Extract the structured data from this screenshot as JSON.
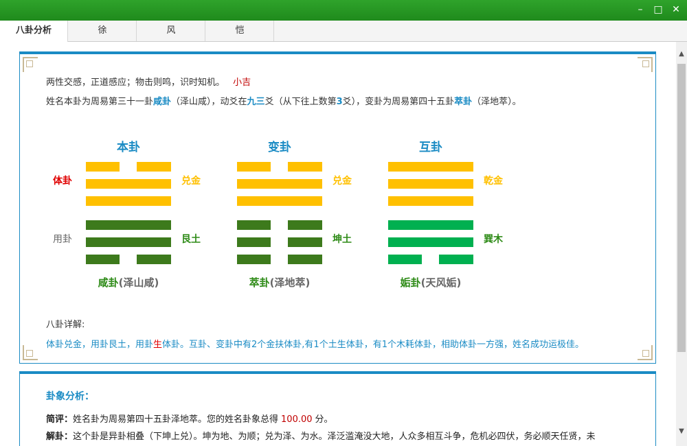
{
  "window": {
    "minimize_label": "–",
    "maximize_label": "□",
    "close_label": "✕"
  },
  "tabs": [
    {
      "label": "八卦分析"
    },
    {
      "label": "徐"
    },
    {
      "label": "风"
    },
    {
      "label": "恺"
    }
  ],
  "analysis": {
    "summary_text": "两性交感，正道感应；物击则鸣，识时知机。",
    "summary_fortune": "小吉",
    "desc_1": "姓名本卦为周易第三十一卦",
    "desc_gua1": "咸卦",
    "desc_2": "（泽山咸），动爻在",
    "desc_yao": "九三",
    "desc_3": "爻（从下往上数第",
    "desc_num": "3",
    "desc_4": "爻），变卦为周易第四十五卦",
    "desc_gua2": "萃卦",
    "desc_5": "（泽地萃）。"
  },
  "hexagrams": [
    {
      "title": "本卦",
      "upper_label": "兑金",
      "lower_label": "艮土",
      "name": "咸卦",
      "full": "(泽山咸)",
      "lines": [
        [
          1,
          0
        ],
        [
          1,
          1
        ],
        [
          1,
          1
        ],
        [
          0,
          1
        ],
        [
          0,
          1
        ],
        [
          1,
          0
        ]
      ]
    },
    {
      "title": "变卦",
      "upper_label": "兑金",
      "lower_label": "坤土",
      "name": "萃卦",
      "full": "(泽地萃)",
      "lines": [
        [
          1,
          0
        ],
        [
          1,
          1
        ],
        [
          1,
          1
        ],
        [
          1,
          0
        ],
        [
          1,
          0
        ],
        [
          1,
          0
        ]
      ]
    },
    {
      "title": "互卦",
      "upper_label": "乾金",
      "lower_label": "巽木",
      "name": "姤卦",
      "full": "(天风姤)",
      "lines": [
        [
          1,
          1
        ],
        [
          1,
          1
        ],
        [
          1,
          1
        ],
        [
          1,
          1
        ],
        [
          1,
          1
        ],
        [
          1,
          0
        ]
      ]
    }
  ],
  "roles": {
    "ti": "体卦",
    "yong": "用卦"
  },
  "detail": {
    "heading": "八卦详解:",
    "text_a": "体卦兑金，用卦艮土，用卦",
    "text_sheng": "生",
    "text_b": "体卦。互卦、变卦中有2个金扶体卦,有1个土生体卦，有1个木耗体卦，相助体卦一方强，姓名成功运极佳。"
  },
  "guaxiang": {
    "heading": "卦象分析：",
    "jianping_label": "简评：",
    "jianping_text": "姓名卦为周易第四十五卦泽地萃。您的姓名卦象总得",
    "score": "100.00",
    "score_unit": "分。",
    "jiegua_label": "解卦：",
    "jiegua_text": "这个卦是异卦相叠（下坤上兑）。坤为地、为顺；兑为泽、为水。泽泛滥淹没大地，人众多相互斗争，危机必四伏，务必顺天任贤，未"
  },
  "colors": {
    "yang_upper": "#ffc000",
    "lower_a": "#3d7a1c",
    "lower_b": "#00b050",
    "accent": "#1a8bc4",
    "ti_red": "#e00000"
  }
}
